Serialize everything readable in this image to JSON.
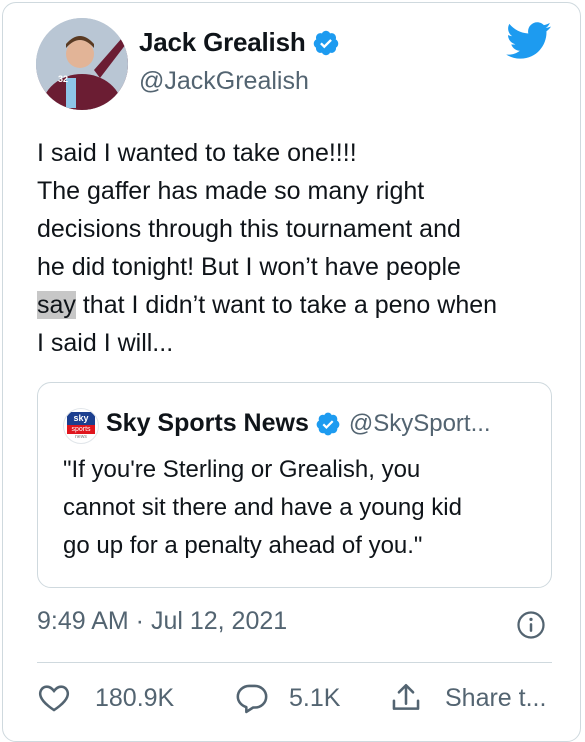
{
  "author": {
    "name": "Jack Grealish",
    "handle": "@JackGrealish",
    "verified": true,
    "avatar_icon": "profile-photo"
  },
  "platform_icon": "twitter-bird-icon",
  "tweet": {
    "lines": [
      "I said I wanted to take one!!!!",
      "The gaffer has made so many right",
      "decisions through this tournament and",
      "he did tonight! But I won’t have people"
    ],
    "highlighted_word": "say",
    "line5_rest": " that I didn’t want to take a peno when",
    "line6": "I said I will..."
  },
  "quote": {
    "logo": {
      "top": "sky",
      "middle": "sports",
      "bottom": "news"
    },
    "name": "Sky Sports News",
    "handle": "@SkySport...",
    "verified": true,
    "lines": [
      "\"If you're Sterling or Grealish, you",
      "cannot sit there and have a young kid",
      "go up for a penalty ahead of you.\""
    ]
  },
  "timestamp": "9:49 AM · Jul 12, 2021",
  "actions": {
    "likes": "180.9K",
    "replies": "5.1K",
    "share_label": "Share t..."
  },
  "colors": {
    "twitter_blue": "#1d9bf0",
    "secondary_text": "#536471",
    "highlight": "#c7c7c7"
  }
}
